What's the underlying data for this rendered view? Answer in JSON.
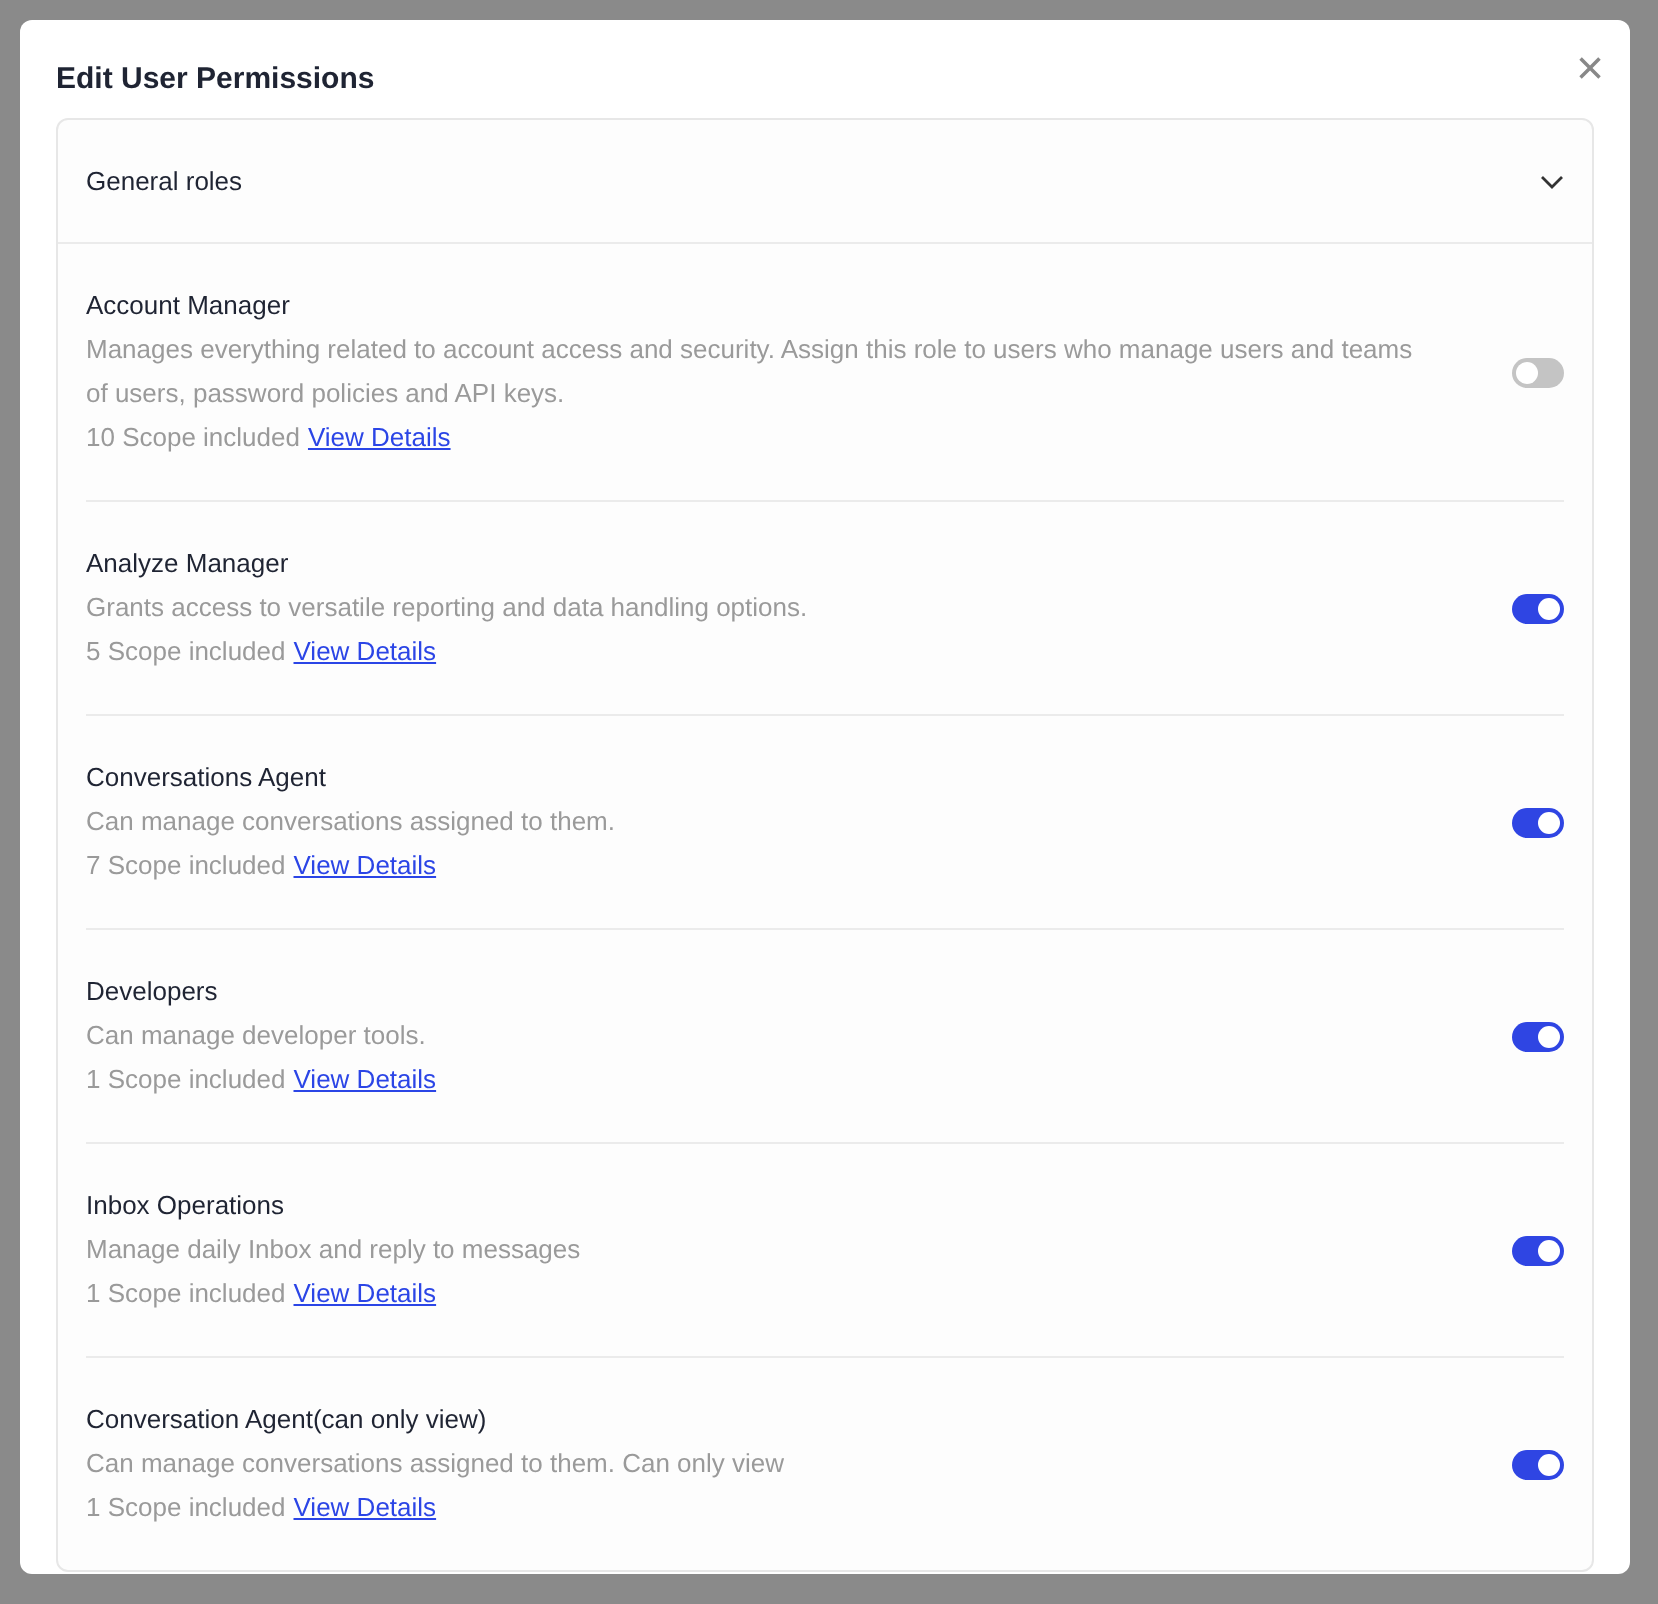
{
  "dialog": {
    "title": "Edit User Permissions",
    "close": "×"
  },
  "section": {
    "title": "General roles",
    "expanded": true
  },
  "roles": [
    {
      "name": "Account Manager",
      "description": "Manages everything related to account access and security. Assign this role to users who manage users and teams of users, password policies and API keys.",
      "scope": "10 Scope included",
      "link": "View Details",
      "on": false
    },
    {
      "name": "Analyze Manager",
      "description": "Grants access to versatile reporting and data handling options.",
      "scope": "5 Scope included",
      "link": "View Details",
      "on": true
    },
    {
      "name": "Conversations Agent",
      "description": "Can manage conversations assigned to them.",
      "scope": "7 Scope included",
      "link": "View Details",
      "on": true
    },
    {
      "name": "Developers",
      "description": "Can manage developer tools.",
      "scope": "1 Scope included",
      "link": "View Details",
      "on": true
    },
    {
      "name": "Inbox Operations",
      "description": "Manage daily Inbox and reply to messages",
      "scope": "1 Scope included",
      "link": "View Details",
      "on": true
    },
    {
      "name": "Conversation Agent(can only view)",
      "description": "Can manage conversations assigned to them. Can only view",
      "scope": "1 Scope included",
      "link": "View Details",
      "on": true
    }
  ]
}
